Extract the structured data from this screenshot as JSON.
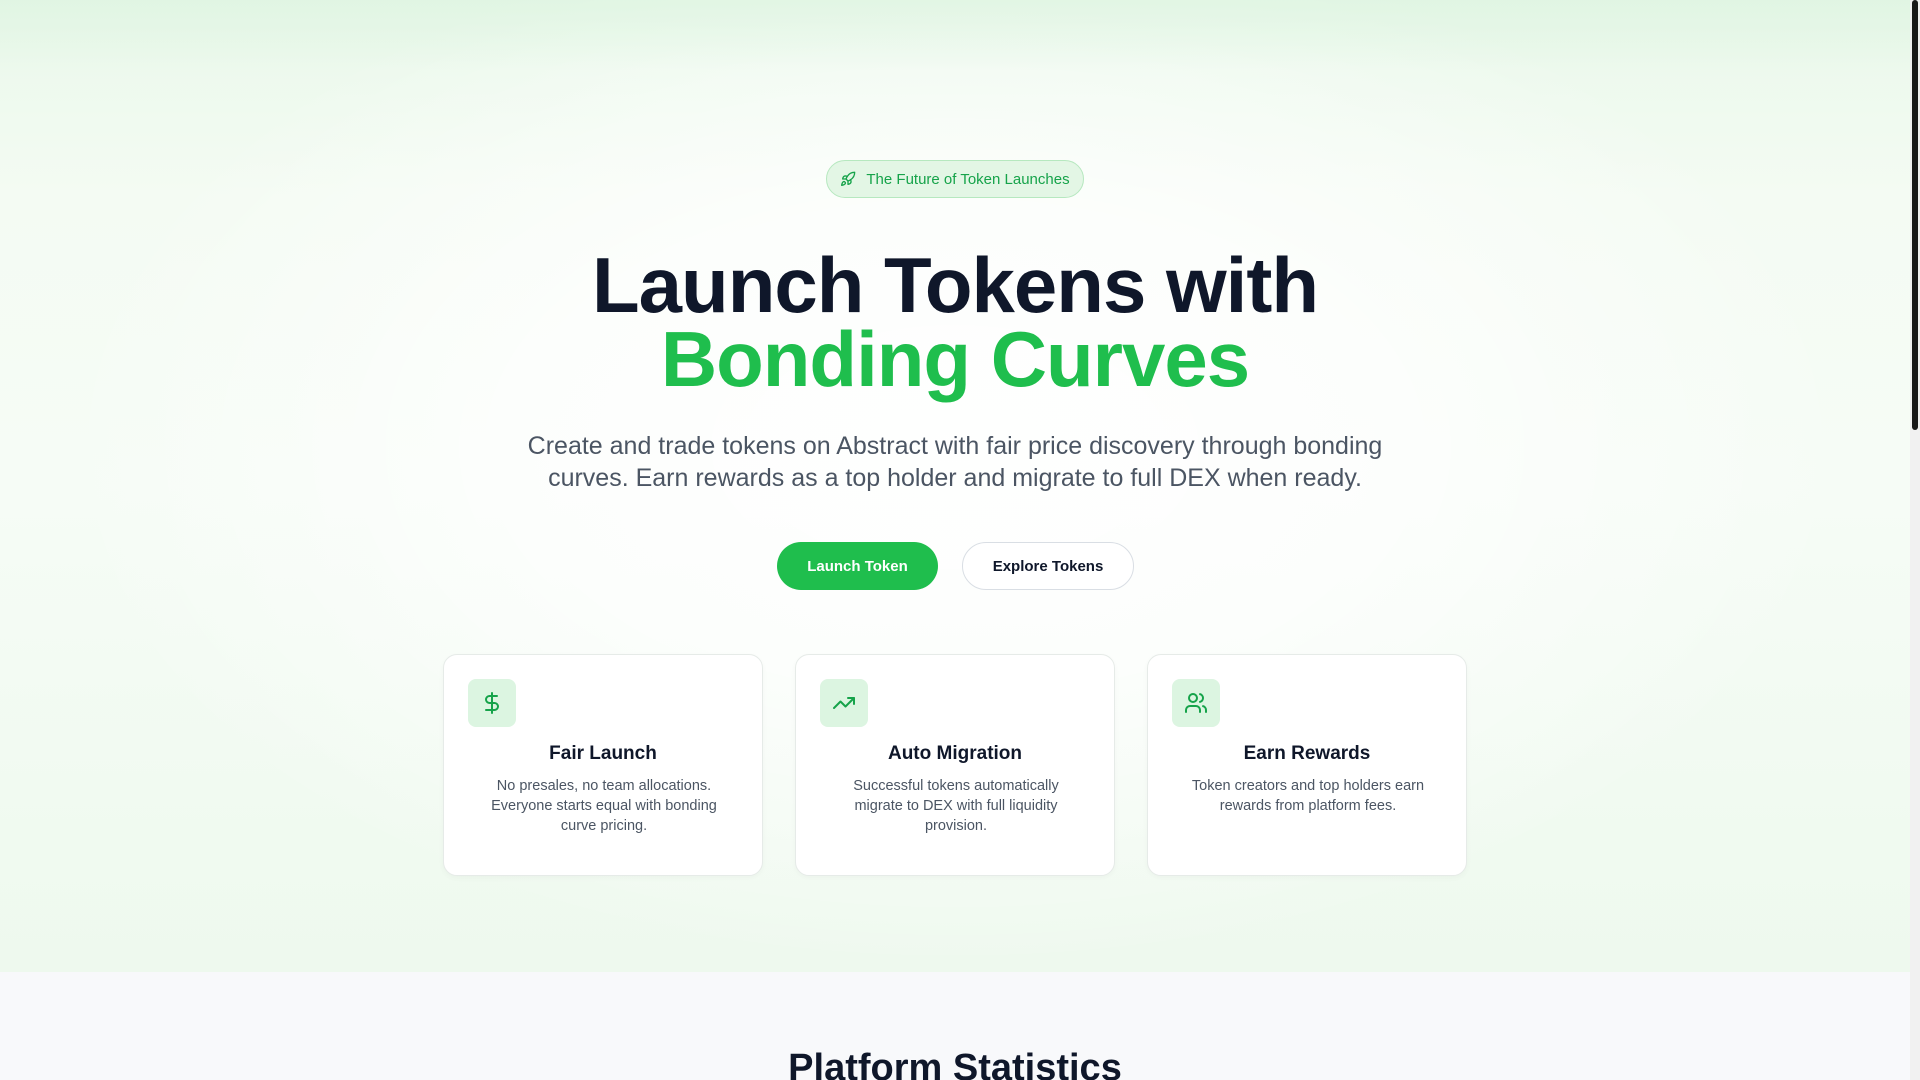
{
  "hero": {
    "badge_text": "The Future of Token Launches",
    "badge_icon": "rocket-icon",
    "headline_line1": "Launch Tokens with",
    "headline_line2": "Bonding Curves",
    "subtitle": "Create and trade tokens on Abstract with fair price discovery through bonding curves. Earn rewards as a top holder and migrate to full DEX when ready.",
    "primary_button": "Launch Token",
    "secondary_button": "Explore Tokens"
  },
  "features": [
    {
      "icon": "dollar-icon",
      "title": "Fair Launch",
      "description": "No presales, no team allocations. Everyone starts equal with bonding curve pricing."
    },
    {
      "icon": "trending-up-icon",
      "title": "Auto Migration",
      "description": "Successful tokens automatically migrate to DEX with full liquidity provision."
    },
    {
      "icon": "users-icon",
      "title": "Earn Rewards",
      "description": "Token creators and top holders earn rewards from platform fees."
    }
  ],
  "stats": {
    "title": "Platform Statistics"
  },
  "colors": {
    "accent": "#1fbe4d",
    "accent_soft": "#dcf5e1",
    "text_primary": "#0f172a",
    "text_secondary": "#4b5563"
  }
}
